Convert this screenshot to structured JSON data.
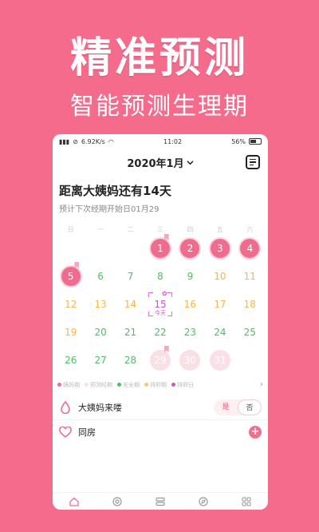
{
  "hero": {
    "title": "精准预测",
    "subtitle": "智能预测生理期"
  },
  "status": {
    "signal": "▮▮▮",
    "speed": "6.92K/s",
    "time": "11:02",
    "battery": "56%"
  },
  "header": {
    "month": "2020年1月"
  },
  "summary": {
    "countdown": "距离大姨妈还有14天",
    "next": "预计下次经期开始日01月29"
  },
  "weekdays": [
    "日",
    "一",
    "二",
    "三",
    "四",
    "五",
    "六"
  ],
  "calendar": [
    {
      "d": "",
      "t": ""
    },
    {
      "d": "",
      "t": ""
    },
    {
      "d": "",
      "t": ""
    },
    {
      "d": "1",
      "t": "period",
      "mark": true
    },
    {
      "d": "2",
      "t": "period"
    },
    {
      "d": "3",
      "t": "period"
    },
    {
      "d": "4",
      "t": "period"
    },
    {
      "d": "5",
      "t": "period",
      "mark": true
    },
    {
      "d": "6",
      "t": "safe"
    },
    {
      "d": "7",
      "t": "safe"
    },
    {
      "d": "8",
      "t": "safe"
    },
    {
      "d": "9",
      "t": "safe"
    },
    {
      "d": "10",
      "t": "ovu"
    },
    {
      "d": "11",
      "t": "ovu"
    },
    {
      "d": "12",
      "t": "ovu"
    },
    {
      "d": "13",
      "t": "ovu"
    },
    {
      "d": "14",
      "t": "ovu"
    },
    {
      "d": "15",
      "t": "today"
    },
    {
      "d": "16",
      "t": "ovu"
    },
    {
      "d": "17",
      "t": "ovu"
    },
    {
      "d": "18",
      "t": "ovu"
    },
    {
      "d": "19",
      "t": "ovu"
    },
    {
      "d": "20",
      "t": "safe"
    },
    {
      "d": "21",
      "t": "safe"
    },
    {
      "d": "22",
      "t": "safe"
    },
    {
      "d": "23",
      "t": "safe"
    },
    {
      "d": "24",
      "t": "safe"
    },
    {
      "d": "25",
      "t": "safe"
    },
    {
      "d": "26",
      "t": "safe"
    },
    {
      "d": "27",
      "t": "safe"
    },
    {
      "d": "28",
      "t": "safe"
    },
    {
      "d": "29",
      "t": "predicted",
      "mark": true
    },
    {
      "d": "30",
      "t": "predicted"
    },
    {
      "d": "31",
      "t": "predicted"
    },
    {
      "d": "",
      "t": ""
    }
  ],
  "today_label": "今天",
  "legend": [
    {
      "label": "姨妈期",
      "color": "#ef6c8f"
    },
    {
      "label": "预测经期",
      "color": "#fbdfe6"
    },
    {
      "label": "安全期",
      "color": "#4bc064"
    },
    {
      "label": "排卵期",
      "color": "#f7c86a"
    },
    {
      "label": "排卵日",
      "color": "#d64dd9"
    }
  ],
  "period_row": {
    "label": "大姨妈来喽",
    "yes": "是",
    "no": "否"
  },
  "intimacy_row": {
    "label": "同房",
    "plus": "+"
  },
  "colors": {
    "accent": "#f46b8c"
  }
}
